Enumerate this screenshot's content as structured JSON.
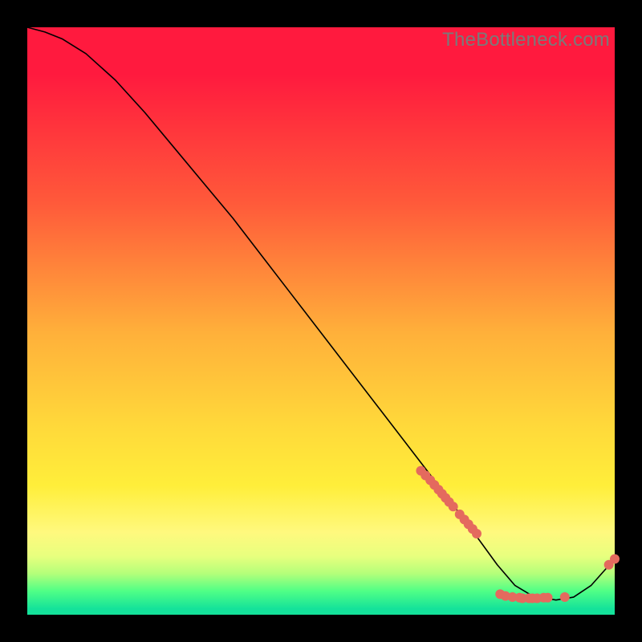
{
  "watermark": "TheBottleneck.com",
  "colors": {
    "dot": "#e46a5e",
    "curve": "#000000",
    "gradient_top": "#ff1a3e",
    "gradient_bottom": "#14e29a"
  },
  "chart_data": {
    "type": "line",
    "title": "",
    "xlabel": "",
    "ylabel": "",
    "xlim": [
      0,
      100
    ],
    "ylim": [
      0,
      100
    ],
    "grid": false,
    "curve_note": "Line descends from top-left, flattens at bottom ~x=82, rises again toward right edge. Y shown as percentage of plot height from bottom.",
    "curve": {
      "x": [
        0,
        3,
        6,
        10,
        15,
        20,
        25,
        30,
        35,
        40,
        45,
        50,
        55,
        60,
        65,
        70,
        73,
        76,
        80,
        83,
        86,
        90,
        93,
        96,
        100
      ],
      "y": [
        100,
        99.2,
        98,
        95.5,
        91,
        85.5,
        79.5,
        73.5,
        67.5,
        61,
        54.5,
        48,
        41.5,
        35,
        28.5,
        22,
        18,
        14,
        8.5,
        5,
        3.2,
        2.5,
        3.0,
        5.0,
        9.5
      ]
    },
    "series": [
      {
        "name": "dot-cluster-1",
        "comment": "dense short run of dots along the descending line segment",
        "x": [
          67.0,
          67.8,
          68.6,
          69.3,
          70.0,
          70.6,
          71.2,
          71.8,
          72.5,
          73.6,
          74.4,
          75.1,
          75.8,
          76.5
        ],
        "y": [
          24.5,
          23.7,
          22.9,
          22.1,
          21.3,
          20.6,
          19.9,
          19.2,
          18.4,
          17.1,
          16.2,
          15.4,
          14.6,
          13.8
        ]
      },
      {
        "name": "dot-cluster-2",
        "comment": "dots along the flat bottom / trough",
        "x": [
          80.5,
          81.4,
          82.6,
          83.8,
          84.3,
          85.4,
          86.0,
          86.8,
          87.9,
          88.6,
          91.5
        ],
        "y": [
          3.5,
          3.2,
          3.0,
          2.9,
          2.8,
          2.8,
          2.8,
          2.8,
          2.9,
          2.9,
          3.0
        ]
      },
      {
        "name": "dot-cluster-3",
        "comment": "two dots on the rising tail at right edge",
        "x": [
          99.0,
          100.0
        ],
        "y": [
          8.5,
          9.5
        ]
      }
    ]
  }
}
